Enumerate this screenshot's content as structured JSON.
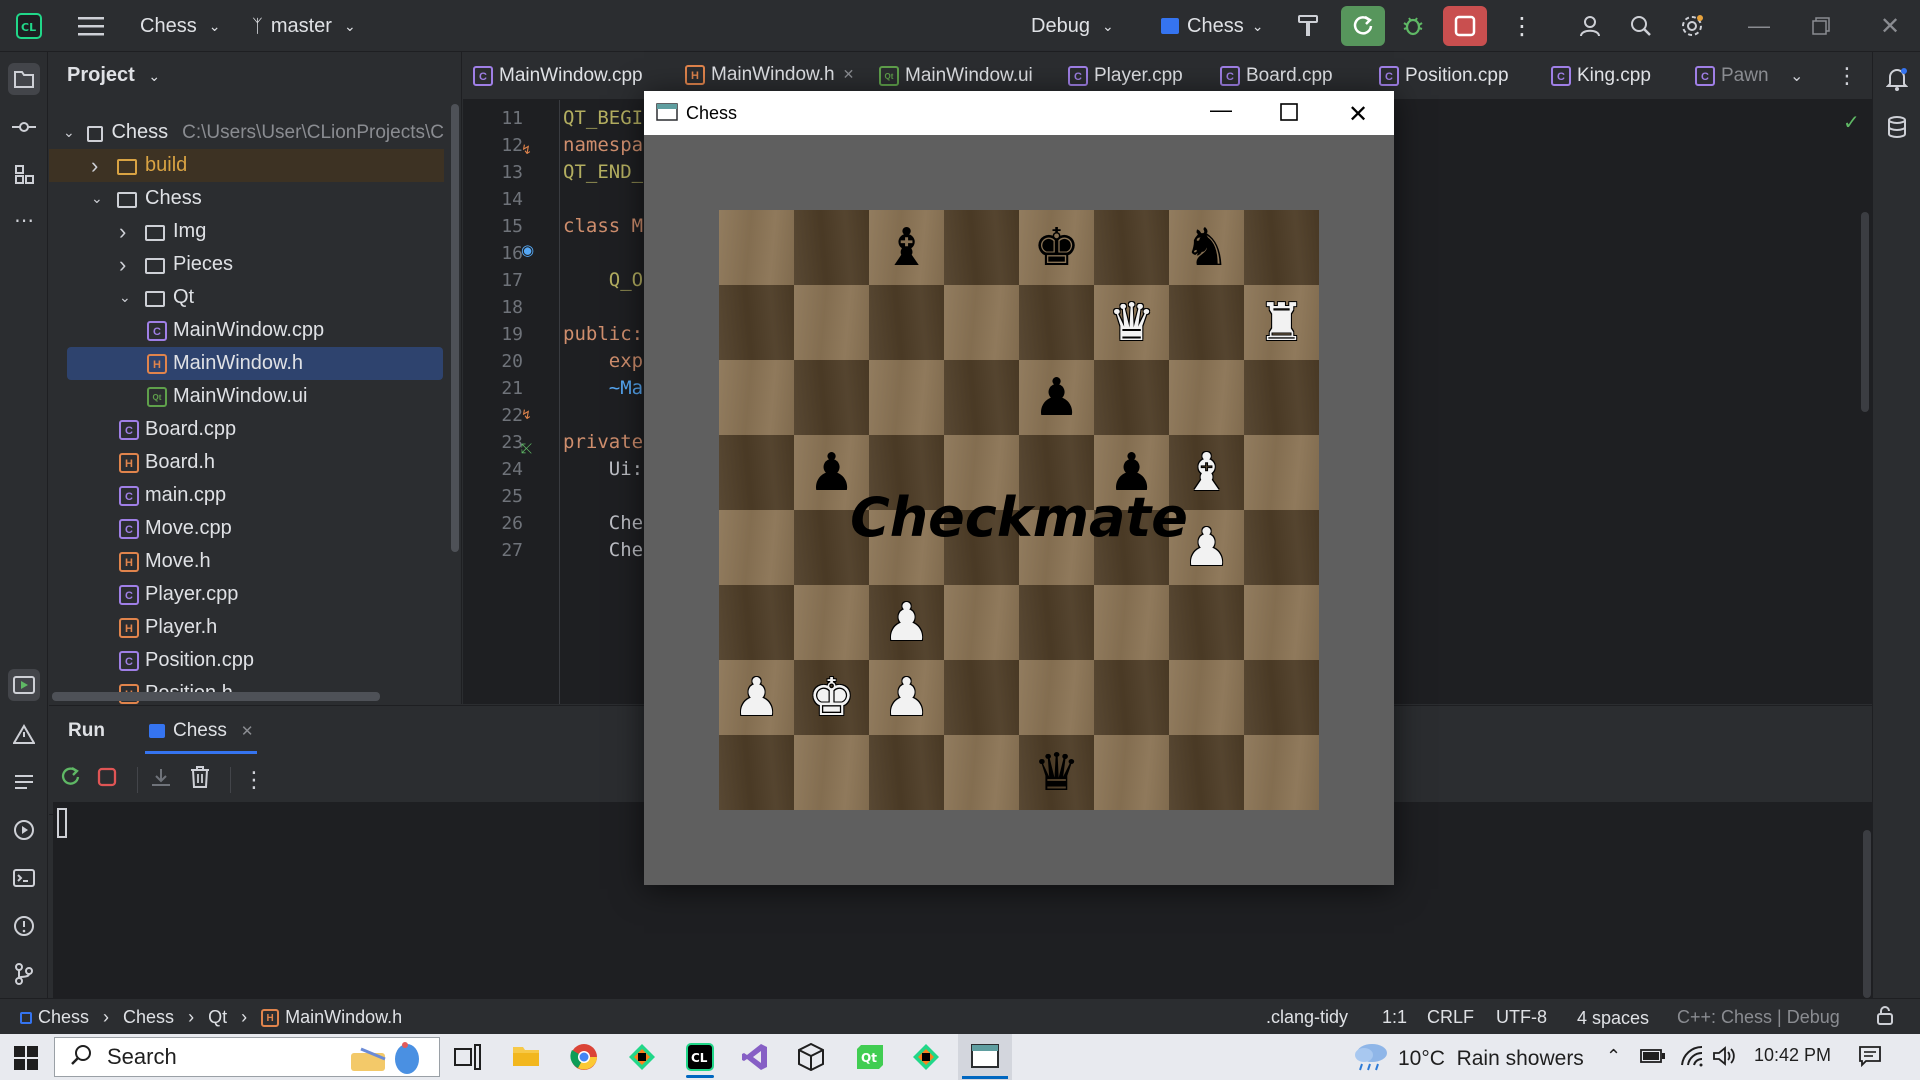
{
  "titlebar": {
    "project": "Chess",
    "branch": "master",
    "config": "Debug",
    "run_target": "Chess"
  },
  "project_panel": {
    "title": "Project",
    "tree": [
      {
        "label": "Chess",
        "path": "C:\\Users\\User\\CLionProjects\\C",
        "type": "folder",
        "indent": 0,
        "open": true
      },
      {
        "label": "build",
        "type": "folder-orange",
        "indent": 1,
        "open": false
      },
      {
        "label": "Chess",
        "type": "folder",
        "indent": 1,
        "open": true
      },
      {
        "label": "Img",
        "type": "folder",
        "indent": 2,
        "open": false
      },
      {
        "label": "Pieces",
        "type": "folder",
        "indent": 2,
        "open": false
      },
      {
        "label": "Qt",
        "type": "folder",
        "indent": 2,
        "open": true
      },
      {
        "label": "MainWindow.cpp",
        "type": "cpp",
        "indent": 3
      },
      {
        "label": "MainWindow.h",
        "type": "h",
        "indent": 3,
        "selected": true
      },
      {
        "label": "MainWindow.ui",
        "type": "ui",
        "indent": 3
      },
      {
        "label": "Board.cpp",
        "type": "cpp",
        "indent": 2
      },
      {
        "label": "Board.h",
        "type": "h",
        "indent": 2
      },
      {
        "label": "main.cpp",
        "type": "cpp",
        "indent": 2
      },
      {
        "label": "Move.cpp",
        "type": "cpp",
        "indent": 2
      },
      {
        "label": "Move.h",
        "type": "h",
        "indent": 2
      },
      {
        "label": "Player.cpp",
        "type": "cpp",
        "indent": 2
      },
      {
        "label": "Player.h",
        "type": "h",
        "indent": 2
      },
      {
        "label": "Position.cpp",
        "type": "cpp",
        "indent": 2
      },
      {
        "label": "Position.h",
        "type": "h",
        "indent": 2
      }
    ]
  },
  "tabs": [
    {
      "label": "MainWindow.cpp",
      "type": "cpp"
    },
    {
      "label": "MainWindow.h",
      "type": "h",
      "active": true
    },
    {
      "label": "MainWindow.ui",
      "type": "ui"
    },
    {
      "label": "Player.cpp",
      "type": "cpp"
    },
    {
      "label": "Board.cpp",
      "type": "cpp"
    },
    {
      "label": "Position.cpp",
      "type": "cpp"
    },
    {
      "label": "King.cpp",
      "type": "cpp"
    },
    {
      "label": "Pawn",
      "type": "cpp"
    }
  ],
  "editor": {
    "lines": [
      {
        "n": "11",
        "text": "QT_BEGI",
        "color": "#b3ae60"
      },
      {
        "n": "12",
        "text": "namespa",
        "color": "#cf8e6d"
      },
      {
        "n": "13",
        "text": "QT_END_",
        "color": "#b3ae60"
      },
      {
        "n": "14",
        "text": "",
        "color": "#bcbec4"
      },
      {
        "n": "15",
        "text": "class M",
        "color": "#cf8e6d"
      },
      {
        "n": "16",
        "text": "",
        "color": "#bcbec4"
      },
      {
        "n": "17",
        "text": "    Q_O",
        "color": "#b3ae60"
      },
      {
        "n": "18",
        "text": "",
        "color": "#bcbec4"
      },
      {
        "n": "19",
        "text": "public:",
        "color": "#cf8e6d"
      },
      {
        "n": "20",
        "text": "    exp",
        "color": "#cf8e6d"
      },
      {
        "n": "21",
        "text": "    ~Ma",
        "color": "#56a8f5"
      },
      {
        "n": "22",
        "text": "",
        "color": "#bcbec4"
      },
      {
        "n": "23",
        "text": "private",
        "color": "#cf8e6d"
      },
      {
        "n": "24",
        "text": "    Ui:",
        "color": "#bcbec4"
      },
      {
        "n": "25",
        "text": "",
        "color": "#bcbec4"
      },
      {
        "n": "26",
        "text": "    Che",
        "color": "#bcbec4"
      },
      {
        "n": "27",
        "text": "    Che",
        "color": "#bcbec4"
      }
    ]
  },
  "run_panel": {
    "title": "Run",
    "tab": "Chess"
  },
  "chess_window": {
    "title": "Chess",
    "overlay_text": "Checkmate",
    "board": [
      [
        "",
        "",
        "b-bishop",
        "",
        "b-king",
        "",
        "b-knight",
        ""
      ],
      [
        "",
        "",
        "",
        "",
        "",
        "w-queen",
        "",
        "w-rook"
      ],
      [
        "",
        "",
        "",
        "",
        "b-pawn",
        "",
        "",
        ""
      ],
      [
        "",
        "b-pawn",
        "",
        "",
        "",
        "b-pawn",
        "w-bishop",
        ""
      ],
      [
        "",
        "",
        "",
        "",
        "",
        "",
        "w-pawn",
        ""
      ],
      [
        "",
        "",
        "w-pawn",
        "",
        "",
        "",
        "",
        ""
      ],
      [
        "w-pawn",
        "w-king",
        "w-pawn",
        "",
        "",
        "",
        "",
        ""
      ],
      [
        "",
        "",
        "",
        "",
        "b-queen",
        "",
        "",
        ""
      ]
    ],
    "light_color": "#8b7455",
    "dark_color": "#4e3d27"
  },
  "breadcrumb": [
    "Chess",
    "Chess",
    "Qt",
    "MainWindow.h"
  ],
  "status": {
    "lint": ".clang-tidy",
    "position": "1:1",
    "line_ending": "CRLF",
    "encoding": "UTF-8",
    "indent": "4 spaces",
    "context": "C++: Chess | Debug"
  },
  "taskbar": {
    "search": "Search",
    "weather": "10°C  Rain showers",
    "time": "10:42 PM"
  }
}
